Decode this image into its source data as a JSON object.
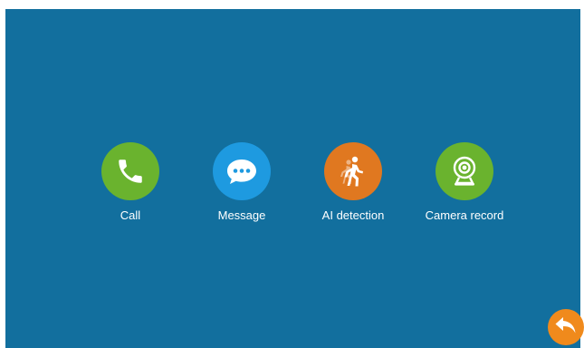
{
  "colors": {
    "background": "#126f9e",
    "call": "#6ab32e",
    "message": "#1e9ae0",
    "ai_detection": "#e07820",
    "camera_record": "#6ab32e",
    "back": "#f08a1c",
    "label": "#ffffff"
  },
  "menu": {
    "items": [
      {
        "id": "call",
        "label": "Call",
        "icon": "phone-icon"
      },
      {
        "id": "message",
        "label": "Message",
        "icon": "chat-bubble-icon"
      },
      {
        "id": "ai_detection",
        "label": "AI detection",
        "icon": "walking-person-icon"
      },
      {
        "id": "camera_record",
        "label": "Camera record",
        "icon": "webcam-icon"
      }
    ]
  },
  "back": {
    "icon": "back-arrow-icon"
  }
}
